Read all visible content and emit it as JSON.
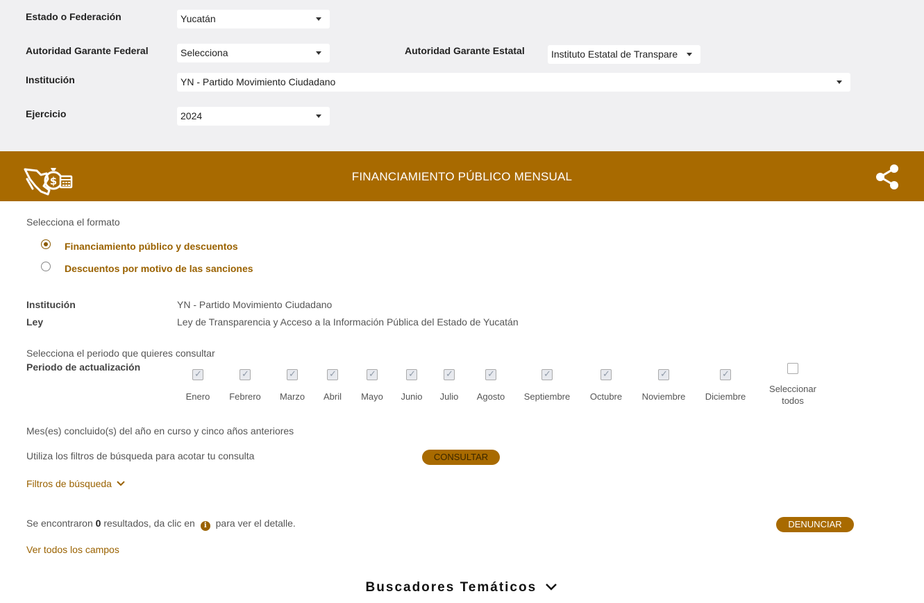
{
  "filters": {
    "estado_label": "Estado o Federación",
    "estado_value": "Yucatán",
    "autoridad_federal_label": "Autoridad Garante Federal",
    "autoridad_federal_value": "Selecciona",
    "autoridad_estatal_label": "Autoridad Garante Estatal",
    "autoridad_estatal_value": "Instituto Estatal de Transpare",
    "institucion_label": "Institución",
    "institucion_value": "YN - Partido Movimiento Ciudadano",
    "ejercicio_label": "Ejercicio",
    "ejercicio_value": "2024"
  },
  "banner": {
    "title": "FINANCIAMIENTO PÚBLICO MENSUAL",
    "logo_icon": "mexico-money-calendar-icon",
    "share_icon": "share-icon",
    "color": "#a86a00"
  },
  "formato": {
    "label": "Selecciona el formato",
    "options": [
      {
        "label": "Financiamiento público y descuentos",
        "selected": true
      },
      {
        "label": "Descuentos por motivo de las sanciones",
        "selected": false
      }
    ]
  },
  "info": {
    "institucion_label": "Institución",
    "institucion_value": "YN - Partido Movimiento Ciudadano",
    "ley_label": "Ley",
    "ley_value": "Ley de Transparencia y Acceso a la Información Pública del Estado de Yucatán"
  },
  "periodo": {
    "prompt": "Selecciona el periodo que quieres consultar",
    "label": "Periodo de actualización",
    "months": [
      "Enero",
      "Febrero",
      "Marzo",
      "Abril",
      "Mayo",
      "Junio",
      "Julio",
      "Agosto",
      "Septiembre",
      "Octubre",
      "Noviembre",
      "Diciembre"
    ],
    "select_all_line1": "Seleccionar",
    "select_all_line2": "todos",
    "note": "Mes(es) concluido(s) del año en curso y cinco años anteriores"
  },
  "consulta": {
    "hint": "Utiliza los filtros de búsqueda para acotar tu consulta",
    "button": "CONSULTAR",
    "filtros_link": "Filtros de búsqueda"
  },
  "results": {
    "prefix": "Se encontraron",
    "count": "0",
    "middle": "resultados, da clic en",
    "suffix": "para ver el detalle.",
    "denunciar": "DENUNCIAR",
    "ver_todos": "Ver todos los campos"
  },
  "footer": {
    "buscadores": "Buscadores Temáticos"
  }
}
